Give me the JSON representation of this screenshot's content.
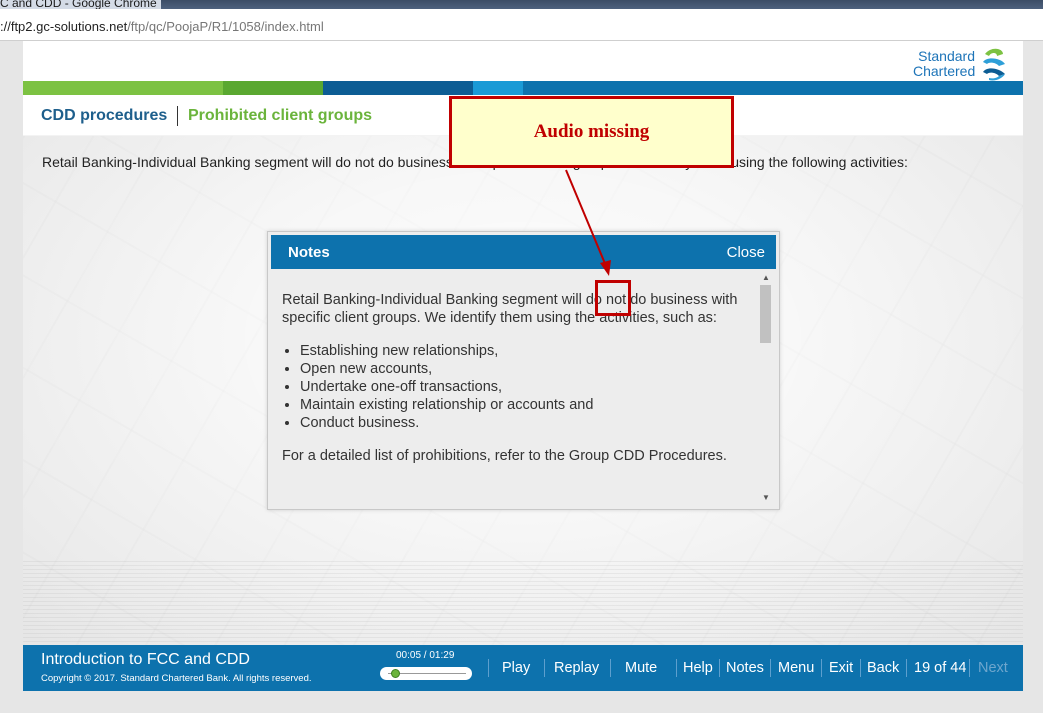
{
  "browser": {
    "window_title": "C and CDD - Google Chrome",
    "url_host": "://ftp2.gc-solutions.net",
    "url_path": "/ftp/qc/PoojaP/R1/1058/index.html"
  },
  "header": {
    "logo_line1": "Standard",
    "logo_line2": "Chartered",
    "brand_blue": "#1d74b8",
    "stripe_colors": [
      "#7cc242",
      "#2e9fd8",
      "#0d5d94",
      "#1a8fd1",
      "#0d72ad"
    ]
  },
  "breadcrumb": {
    "section": "CDD procedures",
    "topic": "Prohibited client groups"
  },
  "intro_text": "Retail Banking-Individual Banking segment will do not do business with specific client groups. We identify them using the following activities:",
  "notes": {
    "title": "Notes",
    "close_label": "Close",
    "paragraph1": "Retail Banking-Individual Banking segment will do not do business with specific client groups. We identify them using the activities, such as:",
    "bullets": [
      "Establishing new relationships,",
      "Open new accounts,",
      "Undertake one-off transactions,",
      "Maintain existing relationship or accounts and",
      "Conduct business."
    ],
    "paragraph2": "For a detailed list of prohibitions, refer to the Group CDD Procedures."
  },
  "footer": {
    "course_title": "Introduction to FCC and CDD",
    "copyright": "Copyright © 2017. Standard Chartered Bank. All rights reserved.",
    "time": "00:05 / 01:29",
    "progress_fraction": 0.06,
    "buttons": {
      "play": "Play",
      "replay": "Replay",
      "mute": "Mute",
      "help": "Help",
      "notes": "Notes",
      "menu": "Menu",
      "exit": "Exit",
      "back": "Back",
      "next": "Next"
    },
    "page_counter": "19 of 44"
  },
  "annotation": {
    "label": "Audio missing",
    "color": "#c00000"
  }
}
